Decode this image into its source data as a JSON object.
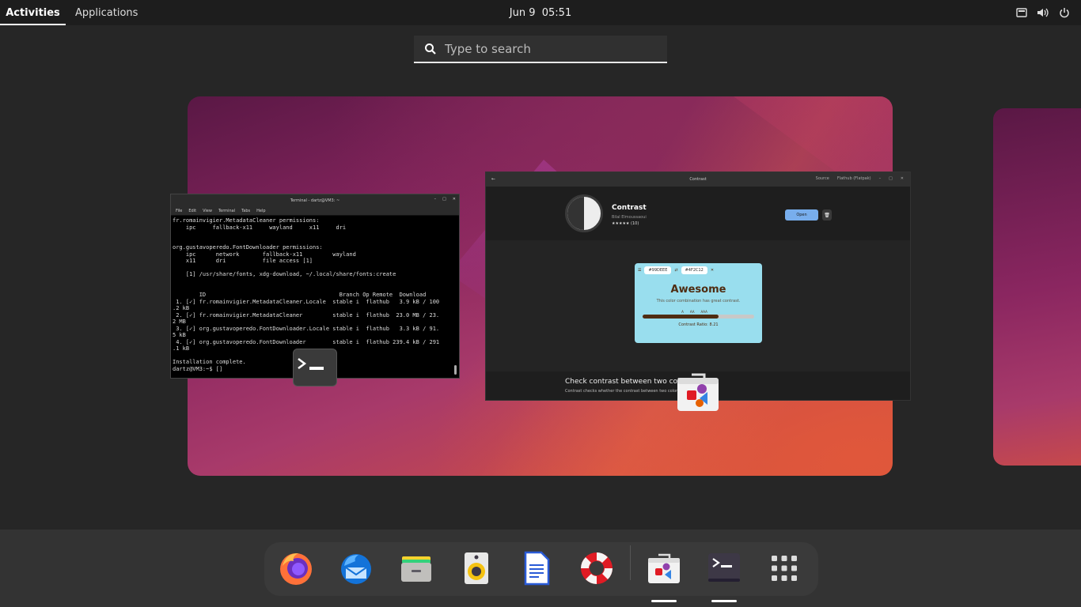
{
  "topbar": {
    "activities": "Activities",
    "applications": "Applications",
    "clock": "Jun 9  05:51"
  },
  "search": {
    "placeholder": "Type to search"
  },
  "terminal": {
    "title": "Terminal - dartz@VM3: ~",
    "menu": [
      "File",
      "Edit",
      "View",
      "Terminal",
      "Tabs",
      "Help"
    ],
    "lines": [
      "fr.romainvigier.MetadataCleaner permissions:",
      "    ipc     fallback-x11     wayland     x11     dri",
      "",
      "",
      "org.gustavoperedo.FontDownloader permissions:",
      "    ipc      network       fallback-x11         wayland",
      "    x11      dri           file access [1]",
      "",
      "    [1] /usr/share/fonts, xdg-download, ~/.local/share/fonts:create",
      "",
      "",
      "        ID                                        Branch Op Remote  Download",
      " 1. [✓] fr.romainvigier.MetadataCleaner.Locale  stable i  flathub   3.9 kB / 100",
      ".2 kB",
      " 2. [✓] fr.romainvigier.MetadataCleaner         stable i  flathub  23.0 MB / 23.",
      "2 MB",
      " 3. [✓] org.gustavoperedo.FontDownloader.Locale stable i  flathub   3.3 kB / 91.",
      "5 kB",
      " 4. [✓] org.gustavoperedo.FontDownloader        stable i  flathub 239.4 kB / 291",
      ".1 kB",
      "",
      "Installation complete.",
      "dartz@VM3:~$ []"
    ]
  },
  "contrast_window": {
    "title": "Contrast",
    "header_right": [
      "Source",
      "Flathub (Flatpak)"
    ],
    "app_name": "Contrast",
    "developer": "Bilal Elmoussaoui",
    "rating": "★★★★★ (10)",
    "open_label": "Open",
    "color1": "#99DEEE",
    "color2": "#4F2C12",
    "rating_word": "Awesome",
    "rating_desc": "This color combination has great contrast.",
    "levels": [
      "A",
      "AA",
      "AAA"
    ],
    "contrast_fill": 0.68,
    "ratio": "Contrast Ratio: 8.21",
    "summary": "Check contrast between two colo",
    "summary_desc": "Contrast checks whether the contrast between two colors m"
  },
  "dock": {
    "apps": [
      {
        "name": "Firefox",
        "icon": "firefox-icon"
      },
      {
        "name": "Thunderbird",
        "icon": "thunderbird-icon"
      },
      {
        "name": "Files",
        "icon": "files-icon"
      },
      {
        "name": "Rhythmbox",
        "icon": "rhythmbox-icon"
      },
      {
        "name": "LibreOffice Writer",
        "icon": "writer-icon"
      },
      {
        "name": "Help",
        "icon": "help-icon"
      },
      {
        "name": "Software",
        "icon": "software-icon"
      },
      {
        "name": "Terminal",
        "icon": "terminal-icon"
      },
      {
        "name": "Show Applications",
        "icon": "app-grid-icon"
      }
    ]
  },
  "colors": {
    "topbar": "#1d1d1d",
    "overview_bg": "#262626",
    "dash_bg": "#333333",
    "accent": "#78aeed"
  }
}
